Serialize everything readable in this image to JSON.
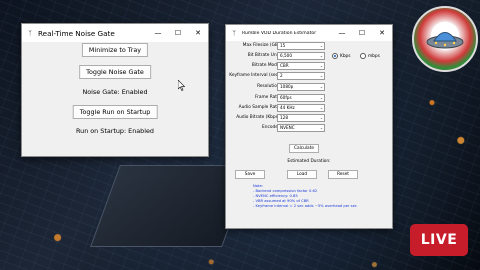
{
  "noise_window": {
    "title": "Real-Time Noise Gate",
    "icon": "feather-icon",
    "buttons": {
      "minimize_tray": "Minimize to Tray",
      "toggle_gate": "Toggle Noise Gate",
      "toggle_startup": "Toggle Run on Startup"
    },
    "status_gate": "Noise Gate: Enabled",
    "status_startup": "Run on Startup: Enabled"
  },
  "est_window": {
    "title": "Rumble VOD Duration Estimator",
    "icon": "feather-icon",
    "fields": [
      {
        "label": "Max Filesize (GB):",
        "value": "15"
      },
      {
        "label": "Bit Bitrate Unit:",
        "value": "6,500"
      },
      {
        "label": "Bitrate Mode:",
        "value": "CBR"
      },
      {
        "label": "Keyframe Interval (sec):",
        "value": "2"
      },
      {
        "label": "Resolution:",
        "value": "1080p"
      },
      {
        "label": "Frame Rate:",
        "value": "60fps"
      },
      {
        "label": "Audio Sample Rate:",
        "value": "44 KHz"
      },
      {
        "label": "Audio Bitrate (Kbps):",
        "value": "128"
      },
      {
        "label": "Encoder:",
        "value": "NVENC"
      }
    ],
    "unit_options": {
      "kbps": "Kbps",
      "mbps": "mbps",
      "selected": "kbps"
    },
    "calculate_label": "Calculate",
    "estimated_label": "Estimated Duration:",
    "save_label": "Save",
    "load_label": "Load",
    "reset_label": "Reset",
    "notes": [
      "Note:",
      "- Backend compression factor 0.62",
      "- NVENC efficiency: 0.85",
      "- VBR assumed at 90% of CBR",
      "- Keyframe interval = 2 sec adds ~5% overhead per sec"
    ]
  },
  "window_controls": {
    "minimize": "—",
    "maximize": "☐",
    "close": "✕"
  },
  "live_badge": "LIVE",
  "colors": {
    "live_red": "#c71d2b",
    "note_blue": "#1a3ad6",
    "radio_blue": "#1a56c9"
  }
}
